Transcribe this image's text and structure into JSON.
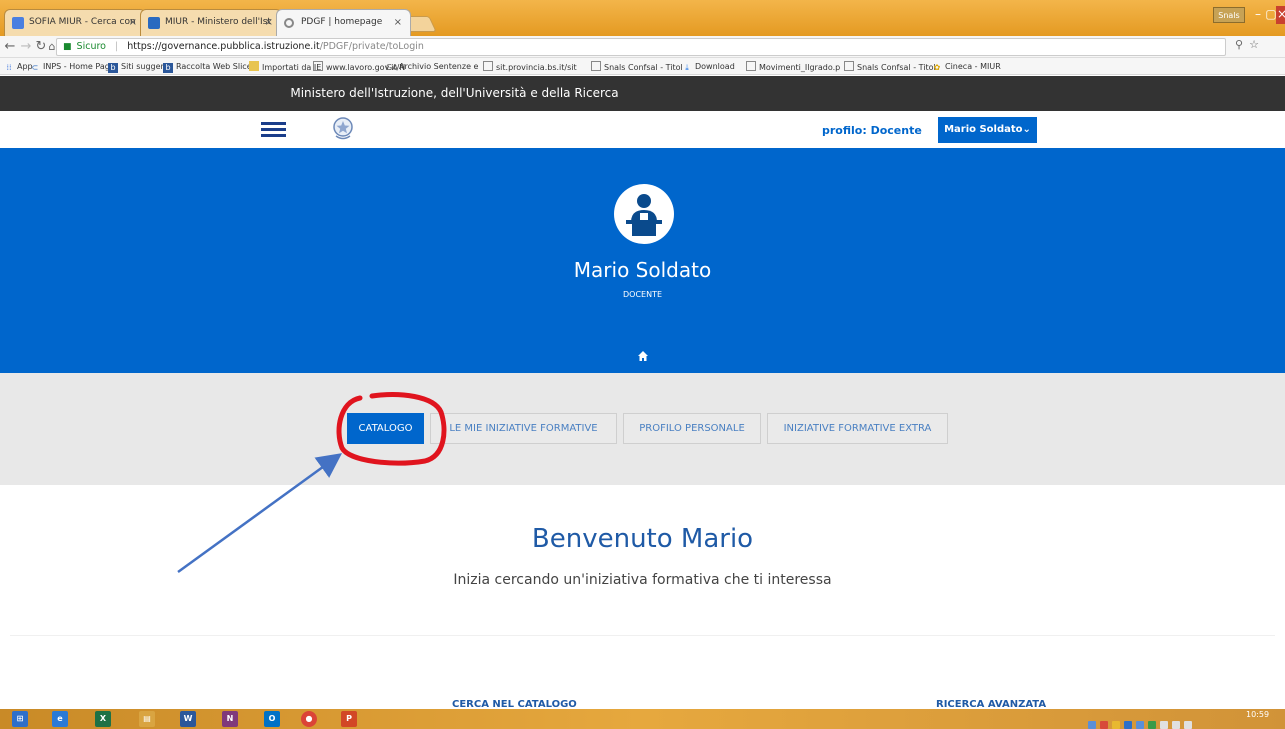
{
  "browser": {
    "tabs": [
      {
        "title": "SOFIA MIUR - Cerca con",
        "favicon_color": "#4a7fe0",
        "active": false
      },
      {
        "title": "MIUR - Ministero dell'Ist",
        "favicon_color": "#2a6ac0",
        "active": false
      },
      {
        "title": "PDGF | homepage",
        "favicon_color": "#888888",
        "active": true
      }
    ],
    "close_glyph": "×",
    "user_chip": "Snals",
    "window_controls": {
      "minimize": "–",
      "maximize": "▢",
      "close": "×"
    },
    "address": {
      "secure_label": "Sicuro",
      "url_domain": "https://governance.pubblica.istruzione.it",
      "url_path": "/PDGF/private/toLogin"
    },
    "bookmarks": [
      {
        "label": "App",
        "icon": "apps-icon"
      },
      {
        "label": "INPS - Home Page",
        "icon": "inps-icon"
      },
      {
        "label": "Siti suggeriti",
        "icon": "suggested-icon"
      },
      {
        "label": "Raccolta Web Slice",
        "icon": "webslice-icon"
      },
      {
        "label": "Importati da IE",
        "icon": "folder-icon"
      },
      {
        "label": "www.lavoro.gov.it/N",
        "icon": "page-icon"
      },
      {
        "label": "Archivio Sentenze e",
        "icon": "ga-icon"
      },
      {
        "label": "sit.provincia.bs.it/sit",
        "icon": "page-icon"
      },
      {
        "label": "Snals Confsal - Titol",
        "icon": "page-icon"
      },
      {
        "label": "Download",
        "icon": "download-icon"
      },
      {
        "label": "Movimenti_Ilgrado.p",
        "icon": "page-icon"
      },
      {
        "label": "Snals Confsal - Titol",
        "icon": "page-icon"
      },
      {
        "label": "Cineca - MIUR",
        "icon": "cineca-icon"
      }
    ]
  },
  "site": {
    "ministry": "Ministero dell'Istruzione, dell'Università e della Ricerca",
    "profile_label": "profilo: Docente",
    "user_menu": "Mario Soldato",
    "user_menu_caret": "⌄",
    "hero": {
      "name": "Mario Soldato",
      "role": "DOCENTE"
    },
    "menu": [
      {
        "label": "CATALOGO",
        "primary": true
      },
      {
        "label": "LE MIE INIZIATIVE FORMATIVE",
        "primary": false
      },
      {
        "label": "PROFILO PERSONALE",
        "primary": false
      },
      {
        "label": "INIZIATIVE FORMATIVE EXTRA",
        "primary": false
      }
    ],
    "welcome_title": "Benvenuto Mario",
    "welcome_subtitle": "Inizia cercando un'iniziativa formativa che ti interessa",
    "bottom_links": {
      "catalog": "CERCA NEL CATALOGO",
      "advanced": "RICERCA AVANZATA"
    }
  },
  "colors": {
    "primary": "#0066cc",
    "annotation_red": "#e0141e",
    "annotation_arrow": "#4472c4"
  },
  "taskbar": {
    "apps": [
      {
        "name": "windows-start",
        "label": "⊞",
        "color": "#2e6fc9"
      },
      {
        "name": "internet-explorer",
        "label": "e",
        "color": "#2a7ad6"
      },
      {
        "name": "excel",
        "label": "X",
        "color": "#1e7145"
      },
      {
        "name": "file-explorer",
        "label": "▤",
        "color": "#d9a441"
      },
      {
        "name": "word",
        "label": "W",
        "color": "#2b579a"
      },
      {
        "name": "onenote",
        "label": "N",
        "color": "#80397b"
      },
      {
        "name": "outlook",
        "label": "O",
        "color": "#0072c6"
      },
      {
        "name": "chrome",
        "label": "●",
        "color": "#db4437"
      },
      {
        "name": "powerpoint",
        "label": "P",
        "color": "#d24726"
      }
    ],
    "clock": "10:59"
  }
}
